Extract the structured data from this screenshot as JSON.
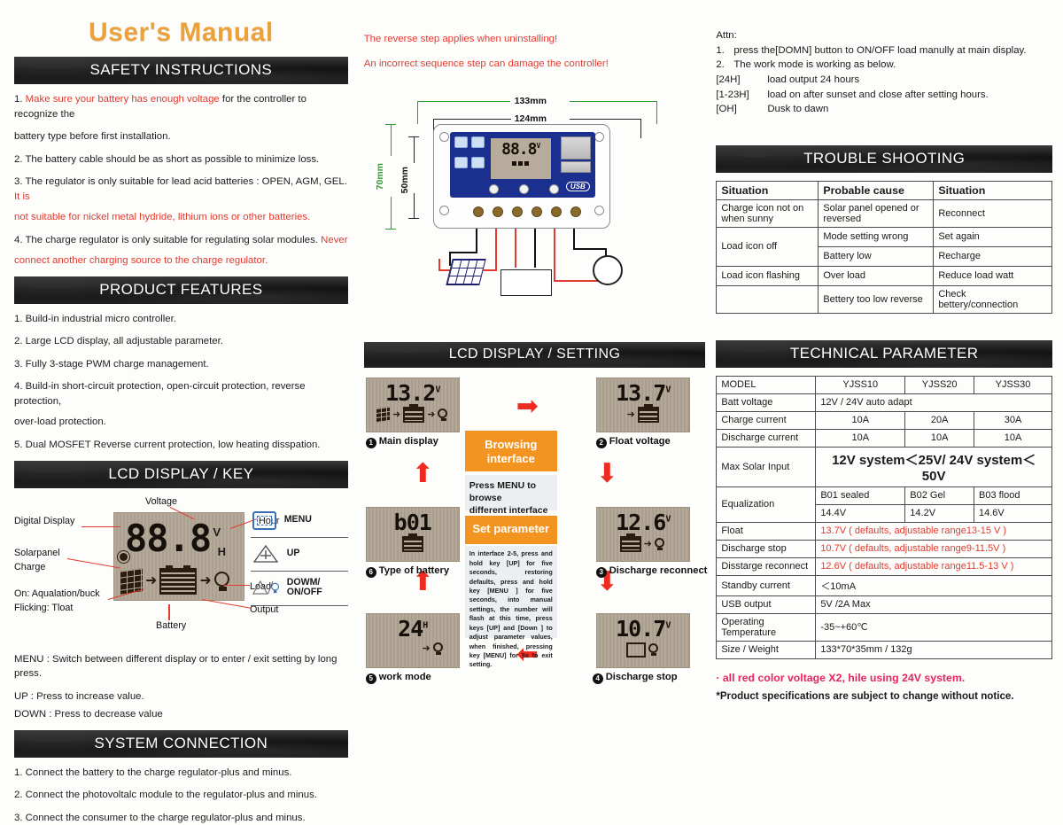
{
  "title": "User's Manual",
  "safety": {
    "heading": "SAFETY INSTRUCTIONS",
    "items": [
      {
        "num": "1. ",
        "red_lead": "Make sure your battery has enough voltage",
        "rest": " for the controller to recognize the"
      },
      {
        "text": "battery type before first installation."
      },
      {
        "text": "2. The battery cable should be as short as possible to minimize loss."
      },
      {
        "num": "3. ",
        "black": "The regulator is only suitable for lead acid batteries : OPEN, AGM, GEL. ",
        "red_tail": "It is"
      },
      {
        "red": "not suitable for nickel metal hydride, lithium ions or other batteries."
      },
      {
        "num": "4. ",
        "black": "The charge regulator is only suitable for regulating solar modules. ",
        "red_tail": "Never"
      },
      {
        "red": "connect another charging source to the charge regulator."
      }
    ]
  },
  "features": {
    "heading": "PRODUCT FEATURES",
    "items": [
      "1. Build-in industrial micro controller.",
      "2. Large LCD display, all adjustable parameter.",
      "3. Fully 3-stage PWM charge management.",
      "4. Build-in short-circuit protection, open-circuit protection, reverse protection,",
      "over-load protection.",
      "5. Dual MOSFET Reverse current protection, low heating disspation."
    ]
  },
  "lcd_key": {
    "heading": "LCD DISPLAY / KEY",
    "labels": {
      "digital_display": "Digital Display",
      "voltage": "Voltage",
      "hour": "Hour",
      "solarpanel": "Solarpanel",
      "charge": "Charge",
      "on_aqualation": "On: Aqualation/buck",
      "flicking": "Flicking: Tloat",
      "load": "Load",
      "output": "Output",
      "battery": "Battery"
    },
    "screen": {
      "digits": "88.8",
      "v": "V",
      "h": "H"
    },
    "keys": [
      {
        "name": "MENU",
        "icon": "menu-screen-icon"
      },
      {
        "name": "UP",
        "icon": "up-triangle-icon"
      },
      {
        "name": "DOWM/\nON/OFF",
        "icon": "down-triangle-lamp-icon"
      }
    ],
    "key_legend": [
      "MENU :  Switch between different display or to enter / exit setting by long press.",
      "UP :        Press to increase value.",
      "DOWN : Press to decrease value"
    ]
  },
  "system_connection": {
    "heading": "SYSTEM CONNECTION",
    "items": [
      "1. Connect the battery to the charge regulator-plus and minus.",
      "2. Connect the photovoltalc module to the regulator-plus and minus.",
      "3. Connect the consumer to the charge regulator-plus and minus."
    ]
  },
  "warnings": {
    "line1": "The reverse step applies when uninstalling!",
    "line2": "An incorrect sequence step can damage the controller!"
  },
  "dimensions": {
    "width_outer": "133mm",
    "width_inner": "124mm",
    "height_outer": "70mm",
    "height_inner": "50mm",
    "device_display": "88.8",
    "device_v": "V",
    "device_h": "H",
    "usb_label": "USB"
  },
  "lcd_setting": {
    "heading": "LCD DISPLAY / SETTING",
    "shots": [
      {
        "id": "1",
        "value": "13.2",
        "unit": "V",
        "caption": "Main display",
        "icons": "panel-battery-lamp"
      },
      {
        "id": "2",
        "value": "13.7",
        "unit": "V",
        "caption": "Float voltage",
        "icons": "battery"
      },
      {
        "id": "3",
        "value": "12.6",
        "unit": "V",
        "caption": "Discharge reconnect",
        "icons": "battery-lamp"
      },
      {
        "id": "4",
        "value": "10.7",
        "unit": "V",
        "caption": "Discharge stop",
        "icons": "empty-battery-lamp"
      },
      {
        "id": "5",
        "value": "24",
        "unit": "H",
        "caption": "work mode",
        "icons": "lamp"
      },
      {
        "id": "6",
        "value": "b01",
        "unit": "",
        "caption": "Type of battery",
        "icons": "battery"
      }
    ],
    "browsing_title": "Browsing\ninterface",
    "browsing_text": "Press MENU to browse\ndifferent interface",
    "set_title": "Set parameter",
    "set_text": "In interface 2-5, press and hold key [UP] for five seconds, restoring defaults, press and hold key [MENU ] for five seconds, into manual settings, the number will flash at this time, press keys [UP] and [Down ] to adjust parameter values, when finished, pressing key [MENU] for 5s to exit setting."
  },
  "attn": {
    "title": "Attn:",
    "item1_num": "1.",
    "item1": "press the[DOMN] button to ON/OFF load manully at main display.",
    "item2_num": "2.",
    "item2": "The work mode is working as below.",
    "modes": [
      {
        "key": "[24H]",
        "desc": "load output 24 hours"
      },
      {
        "key": "[1-23H]",
        "desc": "load on after sunset and close after setting hours."
      },
      {
        "key": "[OH]",
        "desc": "Dusk to dawn"
      }
    ]
  },
  "trouble": {
    "heading": "TROUBLE SHOOTING",
    "columns": [
      "Situation",
      "Probable cause",
      "Situation"
    ],
    "rows": [
      [
        "Charge icon not on when sunny",
        "Solar panel opened or reversed",
        "Reconnect"
      ],
      [
        "Load icon off",
        "Mode setting wrong",
        "Set again"
      ],
      [
        "",
        "Battery low",
        "Recharge"
      ],
      [
        "Load icon flashing",
        "Over load",
        "Reduce load watt"
      ],
      [
        "",
        "Bettery too low reverse",
        "Check bettery/connection"
      ]
    ]
  },
  "technical": {
    "heading": "TECHNICAL PARAMETER",
    "model_label": "MODEL",
    "models": [
      "YJSS10",
      "YJSS20",
      "YJSS30"
    ],
    "rows": [
      {
        "label": "Batt voltage",
        "span": "12V / 24V auto adapt"
      },
      {
        "label": "Charge current",
        "cells": [
          "10A",
          "20A",
          "30A"
        ]
      },
      {
        "label": "Discharge current",
        "cells": [
          "10A",
          "10A",
          "10A"
        ]
      },
      {
        "label": "Max Solar Input",
        "span_big": "12V system＜25V/ 24V system＜50V"
      },
      {
        "label": "Equalization",
        "eq_names": [
          "B01 sealed",
          "B02 Gel",
          "B03 flood"
        ],
        "eq_vals": [
          "14.4V",
          "14.2V",
          "14.6V"
        ]
      },
      {
        "label": "Float",
        "red": "13.7V  ( defaults,  adjustable range13-15 V )"
      },
      {
        "label": "Discharge stop",
        "red": "10.7V  ( defaults,  adjustable range9-11.5V  )"
      },
      {
        "label": "Disstarge reconnect",
        "red": "12.6V  ( defaults,  adjustable range11.5-13 V )"
      },
      {
        "label": "Standby current",
        "span": "＜10mA"
      },
      {
        "label": "USB output",
        "span": "5V /2A Max"
      },
      {
        "label": "Operating Temperature",
        "span": "-35~+60℃"
      },
      {
        "label": "Size / Weight",
        "span": "133*70*35mm / 132g"
      }
    ],
    "footnote_red": "· all red color voltage X2,  hile using 24V system.",
    "footnote_black": "*Product specifications are subject to change without notice."
  },
  "colors": {
    "title_orange": "#eda13a",
    "accent_red": "#e23a2e",
    "pink_red": "#e8245c",
    "bar_dark": "#111111",
    "orange_box": "#f2941f",
    "lcd_bg": "#b2a697",
    "device_blue": "#1b2f8f"
  }
}
